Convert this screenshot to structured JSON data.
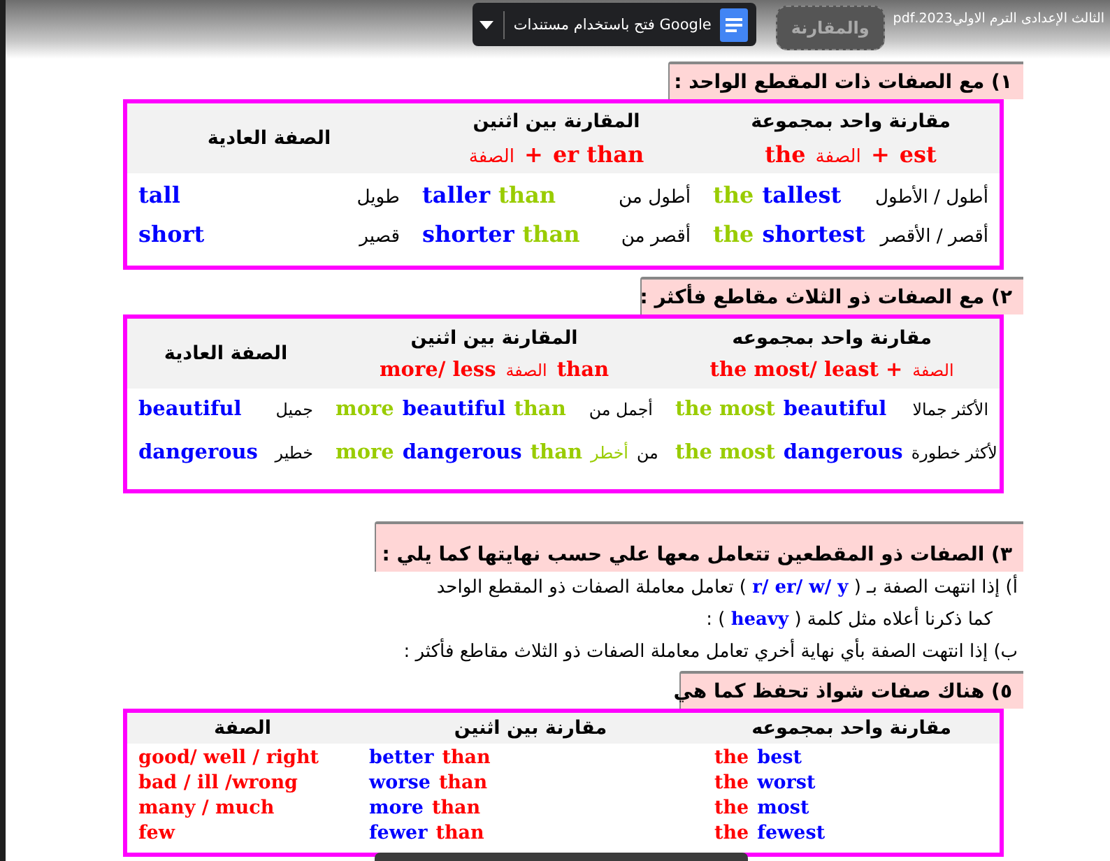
{
  "header": {
    "title": "الثالث الإعدادى الترم الاولي2023.pdf",
    "tooltip": "والمقارنة",
    "open_with": "فتح باستخدام مستندات Google"
  },
  "sections": [
    {
      "kind": "table",
      "heading": "١) مع الصفات ذات المقطع الواحد :",
      "columns": [
        {
          "title": "مقارنة واحد بمجموعة",
          "formula": [
            {
              "text": "the",
              "kind": "rule"
            },
            {
              "text": "الصفة",
              "kind": "rule-ar"
            },
            {
              "text": "+",
              "kind": "rule"
            },
            {
              "text": "est",
              "kind": "rule"
            }
          ]
        },
        {
          "title": "المقارنة بين اثنين",
          "formula": [
            {
              "text": "الصفة",
              "kind": "rule-ar"
            },
            {
              "text": "+",
              "kind": "rule"
            },
            {
              "text": "er than",
              "kind": "rule"
            }
          ]
        },
        {
          "title": "الصفة العادية"
        }
      ],
      "rows": [
        {
          "cells": [
            {
              "en": [
                {
                  "text": "the",
                  "kind": "marker"
                },
                {
                  "text": "tallest",
                  "kind": "word"
                }
              ],
              "ar": [
                {
                  "text": "أطول / الأطول",
                  "kind": "text"
                }
              ]
            },
            {
              "en": [
                {
                  "text": "taller",
                  "kind": "word"
                },
                {
                  "text": "than",
                  "kind": "marker"
                }
              ],
              "ar": [
                {
                  "text": "أطول من",
                  "kind": "text"
                }
              ]
            },
            {
              "en": [
                {
                  "text": "tall",
                  "kind": "word"
                }
              ],
              "ar": [
                {
                  "text": "طويل",
                  "kind": "text"
                }
              ]
            }
          ]
        },
        {
          "cells": [
            {
              "en": [
                {
                  "text": "the",
                  "kind": "marker"
                },
                {
                  "text": "shortest",
                  "kind": "word"
                }
              ],
              "ar": [
                {
                  "text": "أقصر / الأقصر",
                  "kind": "text"
                }
              ]
            },
            {
              "en": [
                {
                  "text": "shorter",
                  "kind": "word"
                },
                {
                  "text": "than",
                  "kind": "marker"
                }
              ],
              "ar": [
                {
                  "text": "أقصر من",
                  "kind": "text"
                }
              ]
            },
            {
              "en": [
                {
                  "text": "short",
                  "kind": "word"
                }
              ],
              "ar": [
                {
                  "text": "قصير",
                  "kind": "text"
                }
              ]
            }
          ]
        }
      ]
    },
    {
      "kind": "table",
      "heading": "٢) مع الصفات ذو الثلاث مقاطع فأكثر :",
      "columns": [
        {
          "title": "مقارنة واحد بمجموعه",
          "formula": [
            {
              "text": "the most/ least +",
              "kind": "rule"
            },
            {
              "text": "الصفة",
              "kind": "rule-ar"
            }
          ]
        },
        {
          "title": "المقارنة بين اثنين",
          "formula": [
            {
              "text": "more/ less",
              "kind": "rule"
            },
            {
              "text": "الصفة",
              "kind": "rule-ar"
            },
            {
              "text": "than",
              "kind": "rule"
            }
          ]
        },
        {
          "title": "الصفة العادية"
        }
      ],
      "rows": [
        {
          "cells": [
            {
              "en": [
                {
                  "text": "the most",
                  "kind": "marker"
                },
                {
                  "text": "beautiful",
                  "kind": "word"
                }
              ],
              "ar": [
                {
                  "text": "الأكثر جمالا",
                  "kind": "text"
                }
              ]
            },
            {
              "en": [
                {
                  "text": "more",
                  "kind": "marker"
                },
                {
                  "text": "beautiful",
                  "kind": "word"
                },
                {
                  "text": "than",
                  "kind": "marker"
                }
              ],
              "ar": [
                {
                  "text": "أجمل من",
                  "kind": "text"
                }
              ]
            },
            {
              "en": [
                {
                  "text": "beautiful",
                  "kind": "word"
                }
              ],
              "ar": [
                {
                  "text": "جميل",
                  "kind": "text"
                }
              ]
            }
          ]
        },
        {
          "cells": [
            {
              "en": [
                {
                  "text": "the most",
                  "kind": "marker"
                },
                {
                  "text": "dangerous",
                  "kind": "word"
                }
              ],
              "ar": [
                {
                  "text": "لأكثر خطورة",
                  "kind": "text"
                }
              ]
            },
            {
              "en": [
                {
                  "text": "more",
                  "kind": "marker"
                },
                {
                  "text": "dangerous",
                  "kind": "word"
                },
                {
                  "text": "than",
                  "kind": "marker"
                }
              ],
              "ar": [
                {
                  "text": "أخطر",
                  "kind": "text-marker"
                },
                {
                  "text": "من",
                  "kind": "text"
                }
              ]
            },
            {
              "en": [
                {
                  "text": "dangerous",
                  "kind": "word"
                }
              ],
              "ar": [
                {
                  "text": "خطير",
                  "kind": "text"
                }
              ]
            }
          ]
        }
      ]
    },
    {
      "kind": "notes",
      "heading": "٣) الصفات ذو المقطعين تتعامل معها علي حسب نهايتها كما يلي :",
      "lines": [
        [
          {
            "text": "أ) إذا انتهت الصفة بـ (",
            "kind": "text"
          },
          {
            "text": "r/ er/ w/ y",
            "kind": "word"
          },
          {
            "text": ") تعامل معاملة الصفات ذو المقطع الواحد",
            "kind": "text"
          }
        ],
        [
          {
            "text": "كما ذكرنا أعلاه مثل كلمة (",
            "kind": "text"
          },
          {
            "text": "heavy",
            "kind": "word"
          },
          {
            "text": ") :",
            "kind": "text"
          }
        ],
        [
          {
            "text": "ب) إذا انتهت الصفة بأي نهاية أخري تعامل معاملة الصفات ذو الثلاث مقاطع فأكثر   :",
            "kind": "text"
          }
        ]
      ]
    },
    {
      "kind": "table",
      "heading": "٥) هناك صفات شواذ تحفظ كما هي",
      "columns": [
        {
          "title": "مقارنة واحد بمجموعه"
        },
        {
          "title": "مقارنة بين اثنين"
        },
        {
          "title": "الصفة"
        }
      ],
      "rows": [
        {
          "cells": [
            {
              "en": [
                {
                  "text": "the",
                  "kind": "rule"
                },
                {
                  "text": "best",
                  "kind": "word"
                }
              ]
            },
            {
              "en": [
                {
                  "text": "better",
                  "kind": "word"
                },
                {
                  "text": "than",
                  "kind": "rule"
                }
              ]
            },
            {
              "en": [
                {
                  "text": "good/ well / right",
                  "kind": "rule"
                }
              ]
            }
          ]
        },
        {
          "cells": [
            {
              "en": [
                {
                  "text": "the",
                  "kind": "rule"
                },
                {
                  "text": "worst",
                  "kind": "word"
                }
              ]
            },
            {
              "en": [
                {
                  "text": "worse",
                  "kind": "word"
                },
                {
                  "text": "than",
                  "kind": "rule"
                }
              ]
            },
            {
              "en": [
                {
                  "text": "bad / ill /wrong",
                  "kind": "rule"
                }
              ]
            }
          ]
        },
        {
          "cells": [
            {
              "en": [
                {
                  "text": "the",
                  "kind": "rule"
                },
                {
                  "text": "most",
                  "kind": "word"
                }
              ]
            },
            {
              "en": [
                {
                  "text": "more",
                  "kind": "word"
                },
                {
                  "text": "than",
                  "kind": "rule"
                }
              ]
            },
            {
              "en": [
                {
                  "text": "many / much",
                  "kind": "rule"
                }
              ]
            }
          ]
        },
        {
          "cells": [
            {
              "en": [
                {
                  "text": "the",
                  "kind": "rule"
                },
                {
                  "text": "fewest",
                  "kind": "word"
                }
              ]
            },
            {
              "en": [
                {
                  "text": "fewer",
                  "kind": "word"
                },
                {
                  "text": "than",
                  "kind": "rule"
                }
              ]
            },
            {
              "en": [
                {
                  "text": "few",
                  "kind": "rule"
                }
              ]
            }
          ]
        }
      ]
    }
  ]
}
